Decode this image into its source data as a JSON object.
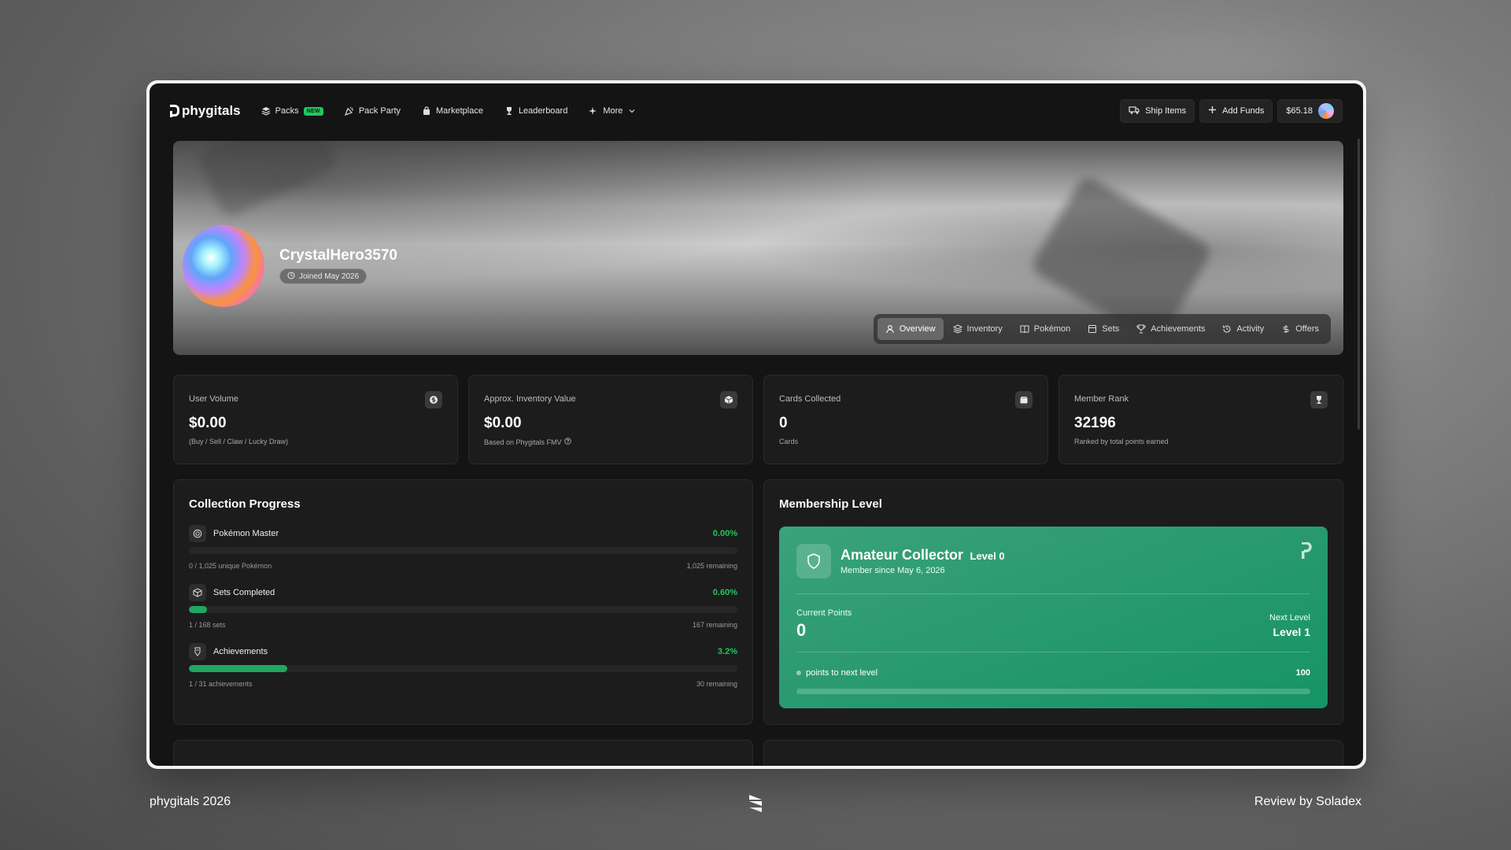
{
  "nav": {
    "logo": "phygitals",
    "items": [
      {
        "label": "Packs",
        "icon": "layers-icon",
        "badge": "NEW"
      },
      {
        "label": "Pack Party",
        "icon": "party-icon"
      },
      {
        "label": "Marketplace",
        "icon": "bag-icon"
      },
      {
        "label": "Leaderboard",
        "icon": "trophy-icon"
      },
      {
        "label": "More",
        "icon": "sparkle-icon"
      }
    ],
    "ship_items": "Ship Items",
    "add_funds": "Add Funds",
    "balance": "$65.18"
  },
  "profile": {
    "username": "CrystalHero3570",
    "joined": "Joined May 2026",
    "tabs": [
      "Overview",
      "Inventory",
      "Pokémon",
      "Sets",
      "Achievements",
      "Activity",
      "Offers"
    ],
    "active_tab": "Overview"
  },
  "stats": [
    {
      "label": "User Volume",
      "value": "$0.00",
      "sub": "(Buy / Sell / Claw / Lucky Draw)",
      "icon": "dollar-icon"
    },
    {
      "label": "Approx. Inventory Value",
      "value": "$0.00",
      "sub": "Based on Phygitals FMV",
      "icon": "box-icon"
    },
    {
      "label": "Cards Collected",
      "value": "0",
      "sub": "Cards",
      "icon": "wallet-icon"
    },
    {
      "label": "Member Rank",
      "value": "32196",
      "sub": "Ranked by total points earned",
      "icon": "trophy-icon"
    }
  ],
  "collection": {
    "title": "Collection Progress",
    "items": [
      {
        "name": "Pokémon Master",
        "pct": "0.00%",
        "fill": 0.0,
        "left": "0 / 1,025 unique Pokémon",
        "right": "1,025 remaining"
      },
      {
        "name": "Sets Completed",
        "pct": "0.60%",
        "fill": 0.6,
        "left": "1 / 168 sets",
        "right": "167 remaining"
      },
      {
        "name": "Achievements",
        "pct": "3.2%",
        "fill": 3.2,
        "left": "1 / 31 achievements",
        "right": "30 remaining"
      }
    ]
  },
  "membership": {
    "title": "Membership Level",
    "tier": "Amateur Collector",
    "level": "Level 0",
    "since": "Member since May 6, 2026",
    "current_points_label": "Current Points",
    "current_points": "0",
    "next_level_label": "Next Level",
    "next_level": "Level 1",
    "points_to_next_label": "points to next level",
    "points_to_next": "100",
    "progress_fraction": 0.0
  },
  "footer": {
    "left": "phygitals 2026",
    "right": "Review by Soladex"
  },
  "colors": {
    "accent_green": "#22c55e",
    "card_green": "#2b9a70",
    "panel": "#1c1c1c"
  }
}
